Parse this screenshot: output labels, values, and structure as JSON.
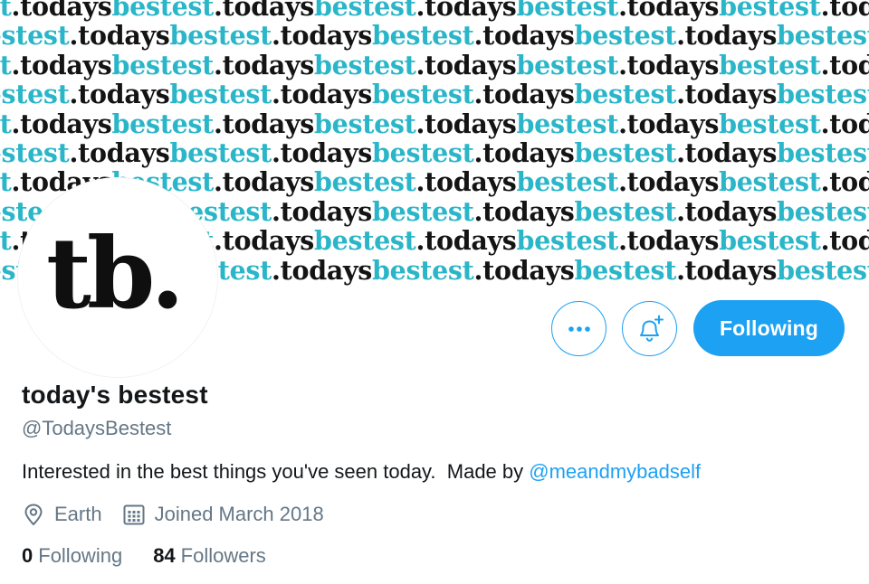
{
  "banner": {
    "word_dark": ".todays",
    "word_accent": "bestest",
    "accent_color": "#2ab6c8",
    "text_color": "#141414"
  },
  "avatar": {
    "mark": "tb."
  },
  "actions": {
    "more_icon": "more-horizontal-icon",
    "notify_icon": "bell-plus-icon",
    "following_label": "Following",
    "accent_color": "#1da1f2"
  },
  "profile": {
    "display_name": "today's bestest",
    "handle": "@TodaysBestest",
    "bio_text": "Interested in the best things you've seen today.  Made by ",
    "bio_mention": "@meandmybadself",
    "location_icon": "location-pin-icon",
    "location": "Earth",
    "joined_icon": "calendar-icon",
    "joined": "Joined March 2018",
    "following_count": "0",
    "following_label": "Following",
    "followers_count": "84",
    "followers_label": "Followers"
  }
}
